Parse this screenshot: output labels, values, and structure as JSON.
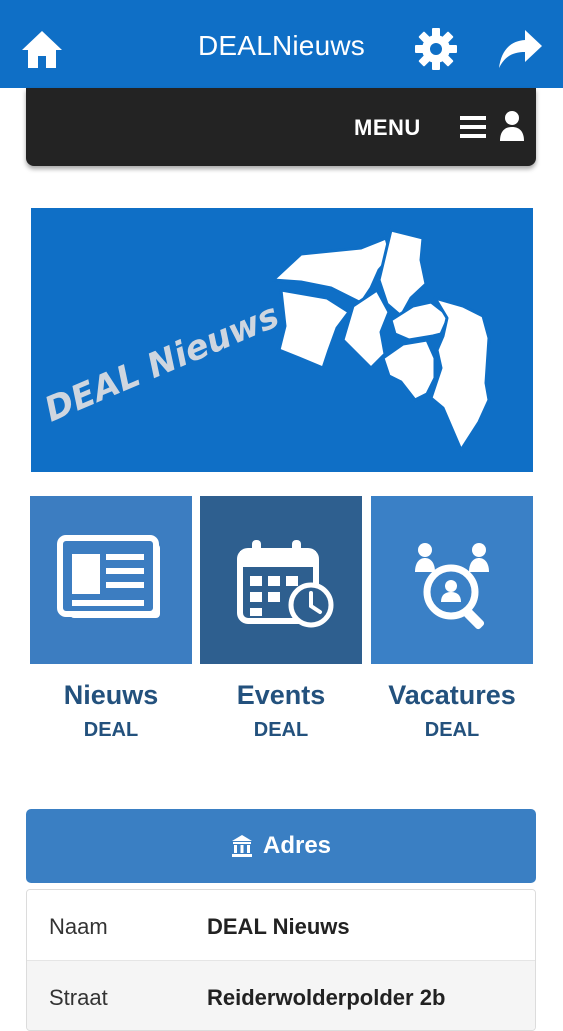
{
  "header": {
    "title": "DEALNieuws",
    "home_icon": "home-icon",
    "settings_icon": "gear-icon",
    "share_icon": "share-arrow-icon"
  },
  "menubar": {
    "label": "MENU",
    "menu_icon": "hamburger-icon",
    "user_icon": "user-icon"
  },
  "banner": {
    "text": "DEAL Nieuws"
  },
  "tiles": [
    {
      "title": "Nieuws",
      "subtitle": "DEAL",
      "icon": "newspaper-icon"
    },
    {
      "title": "Events",
      "subtitle": "DEAL",
      "icon": "calendar-clock-icon"
    },
    {
      "title": "Vacatures",
      "subtitle": "DEAL",
      "icon": "people-search-icon"
    }
  ],
  "adres": {
    "header_label": "Adres",
    "icon": "bank-icon",
    "rows": [
      {
        "label": "Naam",
        "value": "DEAL Nieuws"
      },
      {
        "label": "Straat",
        "value": "Reiderwolderpolder 2b"
      }
    ]
  },
  "colors": {
    "primary_blue": "#0f6fc6",
    "dark_bar": "#232323",
    "tile_news": "#3c7dc1",
    "tile_events": "#2e5f8f",
    "tile_vacatures": "#3a80c6",
    "caption_text": "#23517d"
  }
}
